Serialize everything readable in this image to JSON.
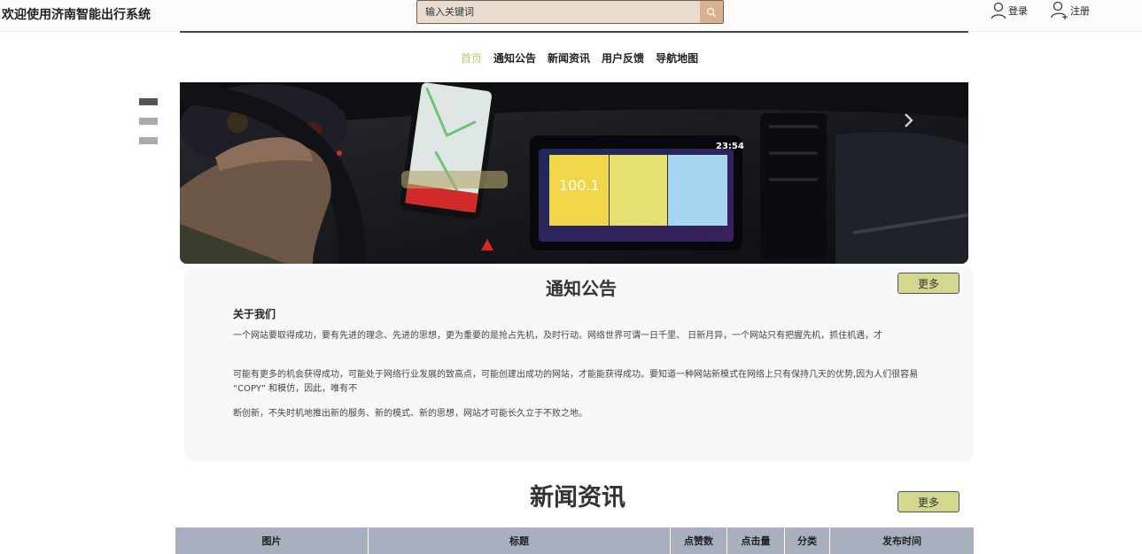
{
  "header": {
    "site_title": "欢迎使用济南智能出行系统",
    "search_placeholder": "输入关键词",
    "login_label": "登录",
    "register_label": "注册"
  },
  "nav": {
    "items": [
      "首页",
      "通知公告",
      "新闻资讯",
      "用户反馈",
      "导航地图"
    ],
    "active": "首页"
  },
  "carousel": {
    "slide_count": 3,
    "active_index": 0,
    "screen_clock": "23:54",
    "screen_value": "100.1"
  },
  "notice": {
    "title": "通知公告",
    "more_label": "更多",
    "article_title": "关于我们",
    "paragraphs": [
      "一个网站要取得成功，要有先进的理念、先进的思想，更为重要的是抢占先机，及时行动。网络世界可谓一日千里、 日新月异，一个网站只有把握先机，抓住机遇，才",
      "可能有更多的机会获得成功，可能处于网络行业发展的致高点，可能创建出成功的网站，才能能获得成功。要知道一种网站新模式在网络上只有保持几天的优势,因为人们很容易 “COPY” 和模仿，因此，唯有不",
      "断创新，不失时机地推出新的服务、新的模式、新的思想，网站才可能长久立于不败之地。"
    ]
  },
  "news": {
    "title": "新闻资讯",
    "more_label": "更多",
    "columns": [
      "图片",
      "标题",
      "点赞数",
      "点击量",
      "分类",
      "发布时间"
    ]
  }
}
